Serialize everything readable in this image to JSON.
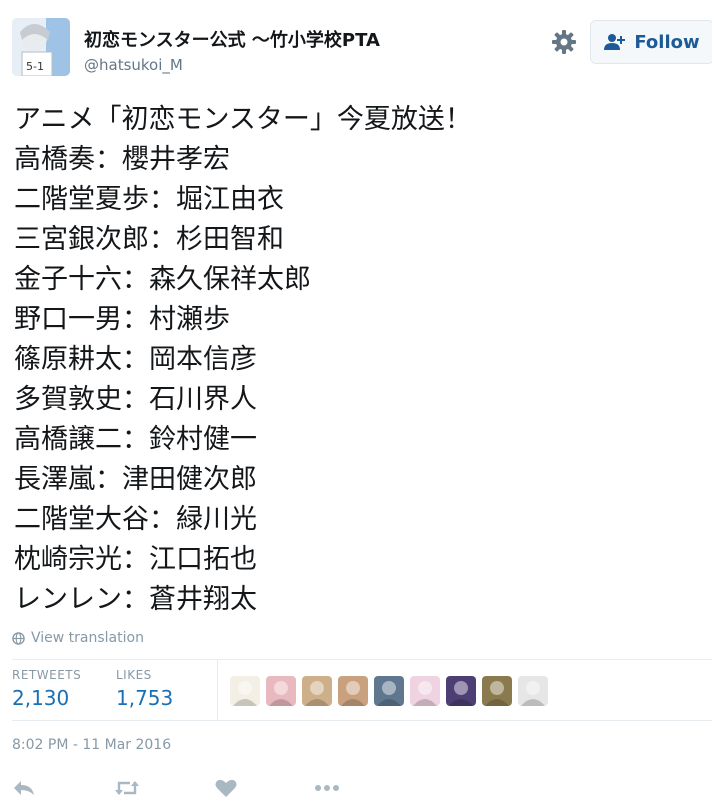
{
  "author": {
    "display_name": "初恋モンスター公式 〜竹小学校PTA",
    "handle": "@hatsukoi_M",
    "avatar_icon": "profile-avatar"
  },
  "header": {
    "settings_icon": "gear-icon",
    "follow_label": "Follow",
    "follow_icon": "add-user-icon"
  },
  "tweet": {
    "lines": [
      "アニメ「初恋モンスター」今夏放送！",
      "高橋奏：櫻井孝宏",
      "二階堂夏歩：堀江由衣",
      "三宮銀次郎：杉田智和",
      "金子十六：森久保祥太郎",
      "野口一男：村瀬歩",
      "篠原耕太：岡本信彦",
      "多賀敦史：石川界人",
      "高橋譲二：鈴村健一",
      "長澤嵐：津田健次郎",
      "二階堂大谷：緑川光",
      "枕崎宗光：江口拓也",
      "レンレン：蒼井翔太"
    ],
    "translate_label": "View translation",
    "translate_icon": "globe-icon"
  },
  "stats": {
    "retweets_label": "RETWEETS",
    "retweets_count": "2,130",
    "likes_label": "LIKES",
    "likes_count": "1,753",
    "liker_avatar_colors": [
      "#f3efe4",
      "#e9b9c0",
      "#cdb08a",
      "#caa17f",
      "#5f7890",
      "#f0d3e0",
      "#4d3f73",
      "#8a7a4e",
      "#e6e6e6"
    ]
  },
  "timestamp": "8:02 PM - 11 Mar 2016",
  "actions": {
    "reply_icon": "reply-icon",
    "retweet_icon": "retweet-icon",
    "like_icon": "heart-icon",
    "more_icon": "more-icon"
  },
  "colors": {
    "accent": "#1b6fb5",
    "follow_text": "#1d5b98",
    "muted": "#8899a6",
    "action_icon": "#aab8c2"
  }
}
